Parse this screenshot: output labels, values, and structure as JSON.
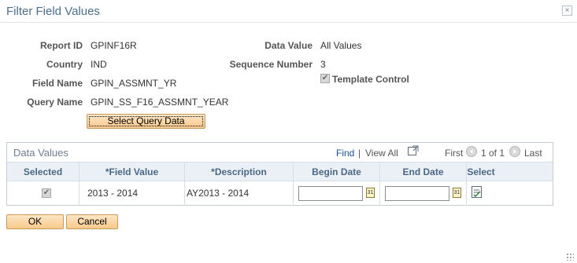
{
  "dialog": {
    "title": "Filter Field Values",
    "close_icon": "×"
  },
  "form": {
    "report_id_label": "Report ID",
    "report_id": "GPINF16R",
    "country_label": "Country",
    "country": "IND",
    "field_name_label": "Field Name",
    "field_name": "GPIN_ASSMNT_YR",
    "query_name_label": "Query Name",
    "query_name": "GPIN_SS_F16_ASSMNT_YEAR",
    "data_value_label": "Data Value",
    "data_value": "All Values",
    "sequence_number_label": "Sequence Number",
    "sequence_number": "3",
    "template_control_label": "Template Control",
    "template_control_checked": true,
    "select_query_button": "Select Query Data"
  },
  "grid": {
    "title": "Data Values",
    "find": "Find",
    "separator": "|",
    "view_all": "View All",
    "first": "First",
    "range": "1 of 1",
    "last": "Last",
    "columns": [
      "Selected",
      "*Field Value",
      "*Description",
      "Begin Date",
      "End Date",
      "Select"
    ],
    "rows": [
      {
        "selected": true,
        "field_value": "2013 - 2014",
        "description": "AY2013 - 2014",
        "begin_date": "",
        "end_date": ""
      }
    ]
  },
  "footer": {
    "ok": "OK",
    "cancel": "Cancel"
  },
  "colors": {
    "title": "#4d6e8c",
    "link": "#1a5294",
    "header_bg": "#eaf0f6",
    "button_top": "#fde6c6",
    "button_bottom": "#f8c98a"
  }
}
